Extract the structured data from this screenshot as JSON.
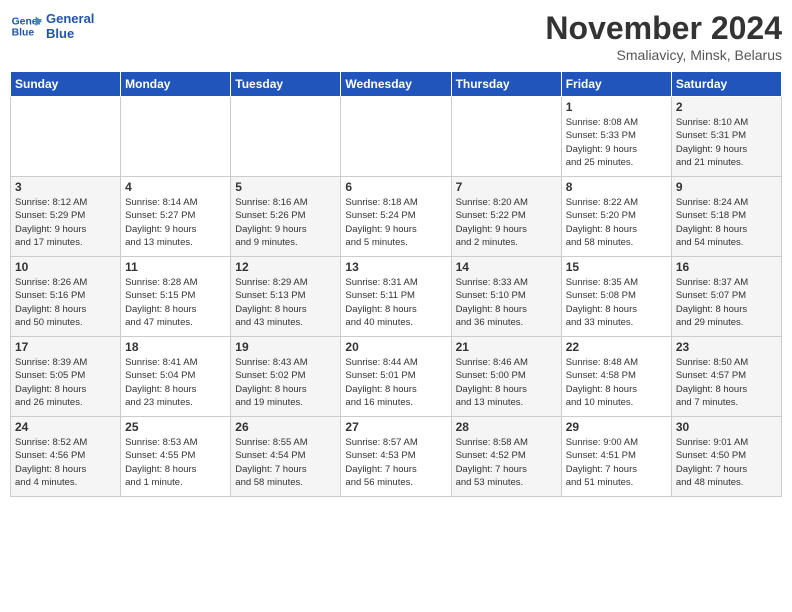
{
  "logo": {
    "line1": "General",
    "line2": "Blue"
  },
  "title": "November 2024",
  "location": "Smaliavicy, Minsk, Belarus",
  "weekdays": [
    "Sunday",
    "Monday",
    "Tuesday",
    "Wednesday",
    "Thursday",
    "Friday",
    "Saturday"
  ],
  "weeks": [
    [
      {
        "day": "",
        "info": ""
      },
      {
        "day": "",
        "info": ""
      },
      {
        "day": "",
        "info": ""
      },
      {
        "day": "",
        "info": ""
      },
      {
        "day": "",
        "info": ""
      },
      {
        "day": "1",
        "info": "Sunrise: 8:08 AM\nSunset: 5:33 PM\nDaylight: 9 hours\nand 25 minutes."
      },
      {
        "day": "2",
        "info": "Sunrise: 8:10 AM\nSunset: 5:31 PM\nDaylight: 9 hours\nand 21 minutes."
      }
    ],
    [
      {
        "day": "3",
        "info": "Sunrise: 8:12 AM\nSunset: 5:29 PM\nDaylight: 9 hours\nand 17 minutes."
      },
      {
        "day": "4",
        "info": "Sunrise: 8:14 AM\nSunset: 5:27 PM\nDaylight: 9 hours\nand 13 minutes."
      },
      {
        "day": "5",
        "info": "Sunrise: 8:16 AM\nSunset: 5:26 PM\nDaylight: 9 hours\nand 9 minutes."
      },
      {
        "day": "6",
        "info": "Sunrise: 8:18 AM\nSunset: 5:24 PM\nDaylight: 9 hours\nand 5 minutes."
      },
      {
        "day": "7",
        "info": "Sunrise: 8:20 AM\nSunset: 5:22 PM\nDaylight: 9 hours\nand 2 minutes."
      },
      {
        "day": "8",
        "info": "Sunrise: 8:22 AM\nSunset: 5:20 PM\nDaylight: 8 hours\nand 58 minutes."
      },
      {
        "day": "9",
        "info": "Sunrise: 8:24 AM\nSunset: 5:18 PM\nDaylight: 8 hours\nand 54 minutes."
      }
    ],
    [
      {
        "day": "10",
        "info": "Sunrise: 8:26 AM\nSunset: 5:16 PM\nDaylight: 8 hours\nand 50 minutes."
      },
      {
        "day": "11",
        "info": "Sunrise: 8:28 AM\nSunset: 5:15 PM\nDaylight: 8 hours\nand 47 minutes."
      },
      {
        "day": "12",
        "info": "Sunrise: 8:29 AM\nSunset: 5:13 PM\nDaylight: 8 hours\nand 43 minutes."
      },
      {
        "day": "13",
        "info": "Sunrise: 8:31 AM\nSunset: 5:11 PM\nDaylight: 8 hours\nand 40 minutes."
      },
      {
        "day": "14",
        "info": "Sunrise: 8:33 AM\nSunset: 5:10 PM\nDaylight: 8 hours\nand 36 minutes."
      },
      {
        "day": "15",
        "info": "Sunrise: 8:35 AM\nSunset: 5:08 PM\nDaylight: 8 hours\nand 33 minutes."
      },
      {
        "day": "16",
        "info": "Sunrise: 8:37 AM\nSunset: 5:07 PM\nDaylight: 8 hours\nand 29 minutes."
      }
    ],
    [
      {
        "day": "17",
        "info": "Sunrise: 8:39 AM\nSunset: 5:05 PM\nDaylight: 8 hours\nand 26 minutes."
      },
      {
        "day": "18",
        "info": "Sunrise: 8:41 AM\nSunset: 5:04 PM\nDaylight: 8 hours\nand 23 minutes."
      },
      {
        "day": "19",
        "info": "Sunrise: 8:43 AM\nSunset: 5:02 PM\nDaylight: 8 hours\nand 19 minutes."
      },
      {
        "day": "20",
        "info": "Sunrise: 8:44 AM\nSunset: 5:01 PM\nDaylight: 8 hours\nand 16 minutes."
      },
      {
        "day": "21",
        "info": "Sunrise: 8:46 AM\nSunset: 5:00 PM\nDaylight: 8 hours\nand 13 minutes."
      },
      {
        "day": "22",
        "info": "Sunrise: 8:48 AM\nSunset: 4:58 PM\nDaylight: 8 hours\nand 10 minutes."
      },
      {
        "day": "23",
        "info": "Sunrise: 8:50 AM\nSunset: 4:57 PM\nDaylight: 8 hours\nand 7 minutes."
      }
    ],
    [
      {
        "day": "24",
        "info": "Sunrise: 8:52 AM\nSunset: 4:56 PM\nDaylight: 8 hours\nand 4 minutes."
      },
      {
        "day": "25",
        "info": "Sunrise: 8:53 AM\nSunset: 4:55 PM\nDaylight: 8 hours\nand 1 minute."
      },
      {
        "day": "26",
        "info": "Sunrise: 8:55 AM\nSunset: 4:54 PM\nDaylight: 7 hours\nand 58 minutes."
      },
      {
        "day": "27",
        "info": "Sunrise: 8:57 AM\nSunset: 4:53 PM\nDaylight: 7 hours\nand 56 minutes."
      },
      {
        "day": "28",
        "info": "Sunrise: 8:58 AM\nSunset: 4:52 PM\nDaylight: 7 hours\nand 53 minutes."
      },
      {
        "day": "29",
        "info": "Sunrise: 9:00 AM\nSunset: 4:51 PM\nDaylight: 7 hours\nand 51 minutes."
      },
      {
        "day": "30",
        "info": "Sunrise: 9:01 AM\nSunset: 4:50 PM\nDaylight: 7 hours\nand 48 minutes."
      }
    ]
  ]
}
